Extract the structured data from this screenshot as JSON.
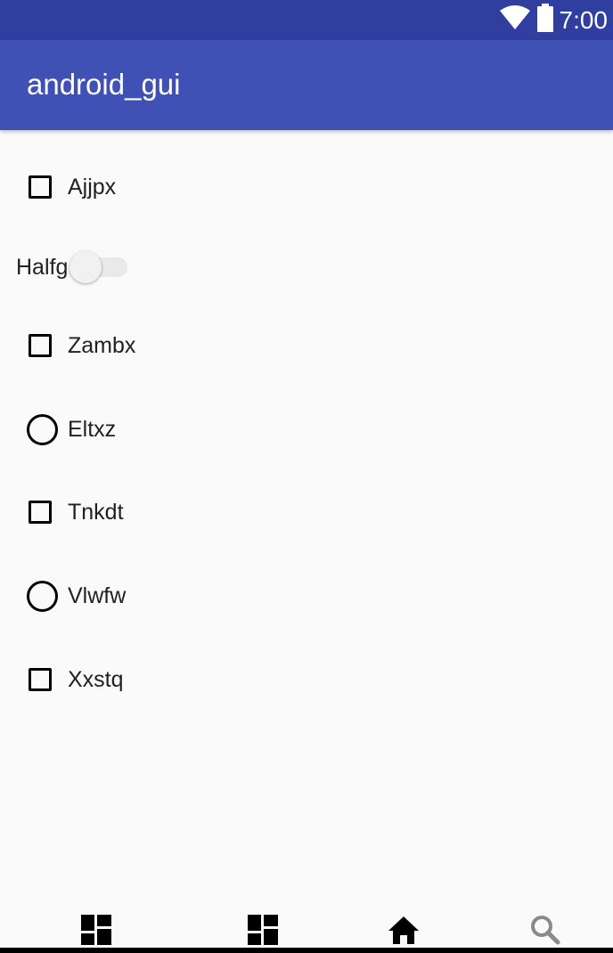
{
  "status_bar": {
    "time": "7:00",
    "icons": [
      "wifi-icon",
      "battery-icon"
    ]
  },
  "app_bar": {
    "title": "android_gui"
  },
  "controls": [
    {
      "kind": "checkbox",
      "label": "Ajjpx",
      "checked": false
    },
    {
      "kind": "switch",
      "label": "Halfg",
      "on": false
    },
    {
      "kind": "checkbox",
      "label": "Zambx",
      "checked": false
    },
    {
      "kind": "radio",
      "label": "Eltxz",
      "selected": false
    },
    {
      "kind": "checkbox",
      "label": "Tnkdt",
      "checked": false
    },
    {
      "kind": "radio",
      "label": "Vlwfw",
      "selected": false
    },
    {
      "kind": "checkbox",
      "label": "Xxstq",
      "checked": false
    }
  ],
  "bottom_nav": {
    "items": [
      {
        "icon": "dashboard-icon"
      },
      {
        "icon": "dashboard-icon"
      },
      {
        "icon": "home-icon"
      },
      {
        "icon": "search-icon"
      }
    ]
  },
  "colors": {
    "status_bar": "#303f9f",
    "app_bar": "#3f51b5",
    "background": "#fafafa"
  }
}
